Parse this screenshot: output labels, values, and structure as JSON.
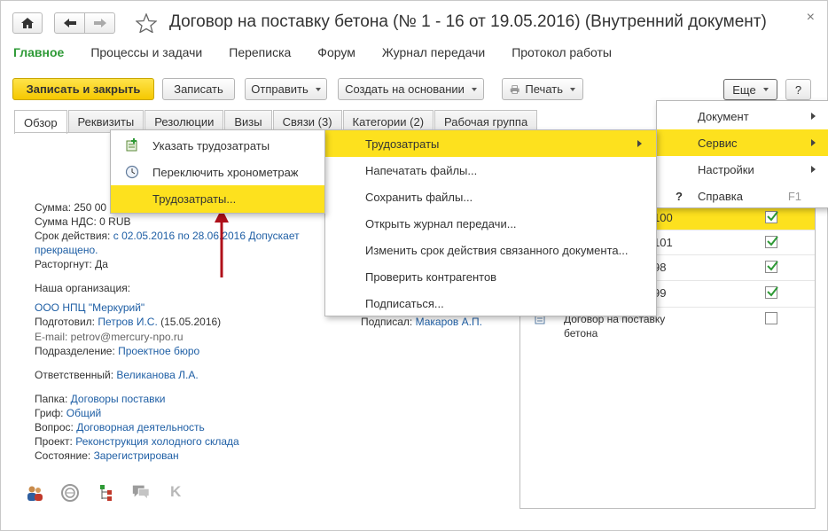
{
  "window": {
    "title": "Договор на поставку бетона (№ 1 - 16 от 19.05.2016) (Внутренний документ)",
    "close_glyph": "×"
  },
  "nav": [
    "Главное",
    "Процессы и задачи",
    "Переписка",
    "Форум",
    "Журнал передачи",
    "Протокол работы"
  ],
  "toolbar": {
    "save_close": "Записать и закрыть",
    "save": "Записать",
    "send": "Отправить",
    "create_based": "Создать на основании",
    "print": "Печать",
    "more": "Еще",
    "help": "?"
  },
  "tabs": [
    "Обзор",
    "Реквизиты",
    "Резолюции",
    "Визы",
    "Связи (3)",
    "Категории (2)",
    "Рабочая группа"
  ],
  "overview": {
    "sum": "Сумма: 250 00",
    "vat": "Сумма НДС: 0 RUB",
    "term_label": "Срок действия:",
    "term_value": "с 02.05.2016 по 28.06.2016 Допускает",
    "term_value2": "прекращено.",
    "terminated": "Расторгнут: Да",
    "our_org_label": "Наша организация:",
    "our_org": "ООО НПЦ \"Меркурий\"",
    "prepared_label": "Подготовил:",
    "prepared_by": "Петров И.С.",
    "prepared_date": "(15.05.2016)",
    "email": "E-mail: petrov@mercury-npo.ru",
    "dept_label": "Подразделение:",
    "dept": "Проектное бюро",
    "resp_label": "Ответственный:",
    "resp": "Великанова Л.А.",
    "folder_label": "Папка:",
    "folder": "Договоры поставки",
    "stamp_label": "Гриф:",
    "stamp": "Общий",
    "question_label": "Вопрос:",
    "question": "Договорная деятельность",
    "project_label": "Проект:",
    "project": "Реконструкция холодного склада",
    "state_label": "Состояние:",
    "state": "Зарегистрирован",
    "signed_label": "Подписал:",
    "signed_by": "Макаров А.П."
  },
  "related": {
    "rows": [
      {
        "text": "100",
        "checked": true
      },
      {
        "text": "101",
        "checked": true
      },
      {
        "text": "98",
        "checked": true
      },
      {
        "text": "99",
        "checked": true
      },
      {
        "text": "Договор на поставку",
        "text2": "бетона",
        "checked": false
      }
    ]
  },
  "menu_more": {
    "items": [
      {
        "label": "Документ",
        "submenu": true
      },
      {
        "label": "Сервис",
        "submenu": true,
        "highlighted": true
      },
      {
        "label": "Настройки",
        "submenu": true
      },
      {
        "label": "Справка",
        "shortcut": "F1",
        "icon": "?"
      }
    ]
  },
  "menu_service": {
    "items": [
      {
        "label": "Трудозатраты",
        "submenu": true,
        "highlighted": true
      },
      {
        "label": "Напечатать файлы..."
      },
      {
        "label": "Сохранить файлы..."
      },
      {
        "label": "Открыть журнал передачи..."
      },
      {
        "label": "Изменить срок действия связанного документа..."
      },
      {
        "label": "Проверить контрагентов"
      },
      {
        "label": "Подписаться..."
      }
    ]
  },
  "menu_labor": {
    "items": [
      {
        "label": "Указать трудозатраты",
        "icon": "add-labor-icon"
      },
      {
        "label": "Переключить хронометраж",
        "icon": "stopwatch-icon"
      },
      {
        "label": "Трудозатраты...",
        "highlighted": true
      }
    ]
  },
  "colors": {
    "accent_yellow": "#fde11e",
    "link_blue": "#1f5fa5",
    "nav_green": "#2e9a36",
    "arrow_red": "#b0101a"
  },
  "bottom_icons": [
    "users-icon",
    "discussion-icon",
    "structure-icon",
    "chat-icon",
    "k-icon"
  ]
}
